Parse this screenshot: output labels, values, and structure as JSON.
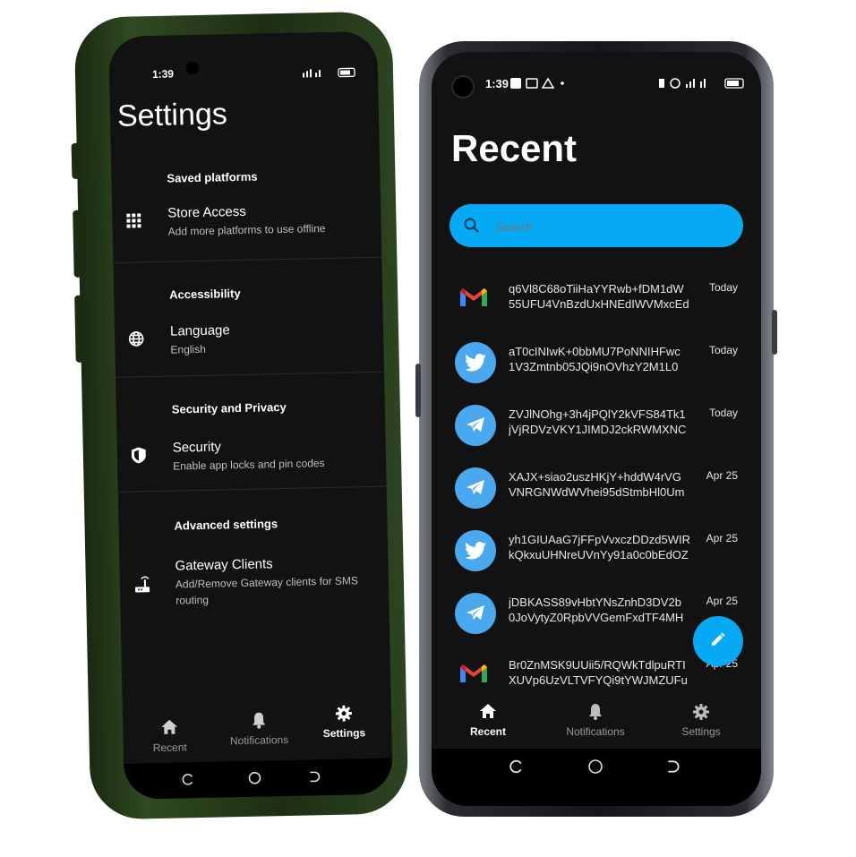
{
  "left_phone": {
    "status": {
      "time": "1:39"
    },
    "title": "Settings",
    "sections": [
      {
        "header": "Saved platforms",
        "item": {
          "icon": "grid-icon",
          "title": "Store Access",
          "subtitle": "Add more platforms to use offline"
        }
      },
      {
        "header": "Accessibility",
        "item": {
          "icon": "globe-icon",
          "title": "Language",
          "subtitle": "English"
        }
      },
      {
        "header": "Security and Privacy",
        "item": {
          "icon": "shield-icon",
          "title": "Security",
          "subtitle": "Enable app locks and pin codes"
        }
      },
      {
        "header": "Advanced settings",
        "item": {
          "icon": "router-icon",
          "title": "Gateway Clients",
          "subtitle_line1": "Add/Remove Gateway clients for SMS",
          "subtitle_line2": "routing"
        }
      }
    ],
    "nav": {
      "recent": "Recent",
      "notifications": "Notifications",
      "settings": "Settings"
    }
  },
  "right_phone": {
    "status": {
      "time": "1:39"
    },
    "title": "Recent",
    "search": {
      "placeholder": "Search"
    },
    "messages": [
      {
        "platform": "gmail",
        "line1": "q6Vl8C68oTiiHaYYRwb+fDM1dW",
        "line2": "55UFU4VnBzdUxHNEdIWVMxcEd",
        "date": "Today"
      },
      {
        "platform": "twitter",
        "line1": "aT0cINIwK+0bbMU7PoNNIHFwc",
        "line2": "1V3Zmtnb05JQi9nOVhzY2M1L0",
        "date": "Today"
      },
      {
        "platform": "telegram",
        "line1": "ZVJlNOhg+3h4jPQlY2kVFS84Tk1",
        "line2": "jVjRDVzVKY1JIMDJ2ckRWMXNC",
        "date": "Today"
      },
      {
        "platform": "telegram",
        "line1": "XAJX+siao2uszHKjY+hddW4rVG",
        "line2": "VNRGNWdWVhei95dStmbHl0Um",
        "date": "Apr 25"
      },
      {
        "platform": "twitter",
        "line1": "yh1GIUAaG7jFFpVvxczDDzd5WIR",
        "line2": "kQkxuUHNreUVnYy91a0c0bEdOZ",
        "date": "Apr 25"
      },
      {
        "platform": "telegram",
        "line1": "jDBKASS89vHbtYNsZnhD3DV2b",
        "line2": "0JoVytyZ0RpbVVGemFxdTF4MH",
        "date": "Apr 25"
      },
      {
        "platform": "gmail",
        "line1": "Br0ZnMSK9UUii5/RQWkTdlpuRTI",
        "line2": "XUVp6UzVLTVFYQi9tYWJMZUFu",
        "date": "Apr 25"
      }
    ],
    "nav": {
      "recent": "Recent",
      "notifications": "Notifications",
      "settings": "Settings"
    }
  },
  "colors": {
    "accent": "#06a9f4",
    "twitter": "#4aa8ee",
    "background": "#121212"
  }
}
